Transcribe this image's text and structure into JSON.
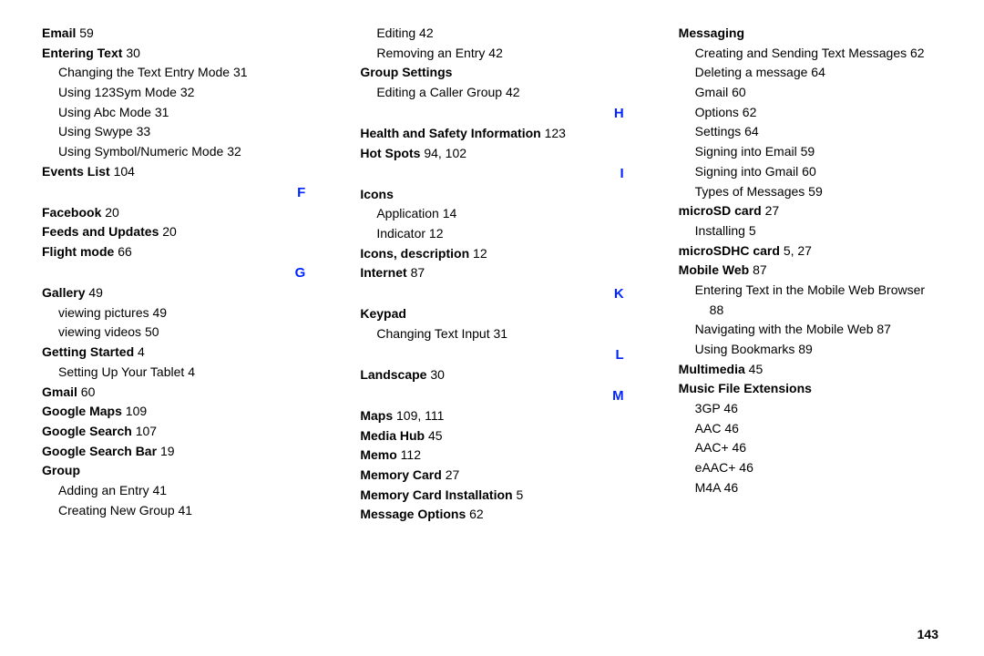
{
  "page_number": "143",
  "letters": {
    "F": "F",
    "G": "G",
    "H": "H",
    "I": "I",
    "K": "K",
    "L": "L",
    "M": "M"
  },
  "e": {
    "email": {
      "t": "Email",
      "p": "59"
    },
    "entering_text": {
      "t": "Entering Text",
      "p": "30"
    },
    "entering_text_subs": [
      {
        "t": "Changing the Text Entry Mode",
        "p": "31"
      },
      {
        "t": "Using 123Sym Mode",
        "p": "32"
      },
      {
        "t": "Using Abc Mode",
        "p": "31"
      },
      {
        "t": "Using Swype",
        "p": "33"
      },
      {
        "t": "Using Symbol/Numeric Mode",
        "p": "32"
      }
    ],
    "events_list": {
      "t": "Events List",
      "p": "104"
    }
  },
  "f": {
    "facebook": {
      "t": "Facebook",
      "p": "20"
    },
    "feeds": {
      "t": "Feeds and Updates",
      "p": "20"
    },
    "flight": {
      "t": "Flight mode",
      "p": "66"
    }
  },
  "g": {
    "gallery": {
      "t": "Gallery",
      "p": "49"
    },
    "gallery_subs": [
      {
        "t": "viewing pictures",
        "p": "49"
      },
      {
        "t": "viewing videos",
        "p": "50"
      }
    ],
    "getting_started": {
      "t": "Getting Started",
      "p": "4"
    },
    "getting_started_subs": [
      {
        "t": "Setting Up Your Tablet",
        "p": "4"
      }
    ],
    "gmail": {
      "t": "Gmail",
      "p": "60"
    },
    "google_maps": {
      "t": "Google Maps",
      "p": "109"
    },
    "google_search": {
      "t": "Google Search",
      "p": "107"
    },
    "google_search_bar": {
      "t": "Google Search Bar",
      "p": "19"
    },
    "group": {
      "t": "Group"
    },
    "group_subs": [
      {
        "t": "Adding an Entry",
        "p": "41"
      },
      {
        "t": "Creating New Group",
        "p": "41"
      },
      {
        "t": "Editing",
        "p": "42"
      },
      {
        "t": "Removing an Entry",
        "p": "42"
      }
    ],
    "group_settings": {
      "t": "Group Settings"
    },
    "group_settings_subs": [
      {
        "t": "Editing a Caller Group",
        "p": "42"
      }
    ]
  },
  "h": {
    "health": {
      "t": "Health and Safety Information",
      "p": "123"
    },
    "hotspots": {
      "t": "Hot Spots",
      "p": "94, 102"
    }
  },
  "i": {
    "icons": {
      "t": "Icons"
    },
    "icons_subs": [
      {
        "t": "Application",
        "p": "14"
      },
      {
        "t": "Indicator",
        "p": "12"
      }
    ],
    "icons_desc": {
      "t": "Icons, description",
      "p": "12"
    },
    "internet": {
      "t": "Internet",
      "p": "87"
    }
  },
  "k": {
    "keypad": {
      "t": "Keypad"
    },
    "keypad_subs": [
      {
        "t": "Changing Text Input",
        "p": "31"
      }
    ]
  },
  "l": {
    "landscape": {
      "t": "Landscape",
      "p": "30"
    }
  },
  "m": {
    "maps": {
      "t": "Maps",
      "p": "109, 111"
    },
    "media_hub": {
      "t": "Media Hub",
      "p": "45"
    },
    "memo": {
      "t": "Memo",
      "p": "112"
    },
    "memory_card": {
      "t": "Memory Card",
      "p": "27"
    },
    "memory_card_install": {
      "t": "Memory Card Installation",
      "p": "5"
    },
    "message_options": {
      "t": "Message Options",
      "p": "62"
    },
    "messaging": {
      "t": "Messaging"
    },
    "messaging_subs": [
      {
        "t": "Creating and Sending Text Messages",
        "p": "62"
      },
      {
        "t": "Deleting a message",
        "p": "64"
      },
      {
        "t": "Gmail",
        "p": "60"
      },
      {
        "t": "Options",
        "p": "62"
      },
      {
        "t": "Settings",
        "p": "64"
      },
      {
        "t": "Signing into Email",
        "p": "59"
      },
      {
        "t": "Signing into Gmail",
        "p": "60"
      },
      {
        "t": "Types of Messages",
        "p": "59"
      }
    ],
    "microsd": {
      "t": "microSD card",
      "p": "27"
    },
    "microsd_subs": [
      {
        "t": "Installing",
        "p": "5"
      }
    ],
    "microsdhc": {
      "t": "microSDHC card",
      "p": "5, 27"
    },
    "mobile_web": {
      "t": "Mobile Web",
      "p": "87"
    },
    "mobile_web_subs": [
      {
        "t": "Entering Text in the Mobile Web Browser",
        "p": "88"
      },
      {
        "t": "Navigating with the Mobile Web",
        "p": "87"
      },
      {
        "t": "Using Bookmarks",
        "p": "89"
      }
    ],
    "multimedia": {
      "t": "Multimedia",
      "p": "45"
    },
    "music_ext": {
      "t": "Music File Extensions"
    },
    "music_ext_subs": [
      {
        "t": "3GP",
        "p": "46"
      },
      {
        "t": "AAC",
        "p": "46"
      },
      {
        "t": "AAC+",
        "p": "46"
      },
      {
        "t": "eAAC+",
        "p": "46"
      },
      {
        "t": "M4A",
        "p": "46"
      }
    ]
  }
}
